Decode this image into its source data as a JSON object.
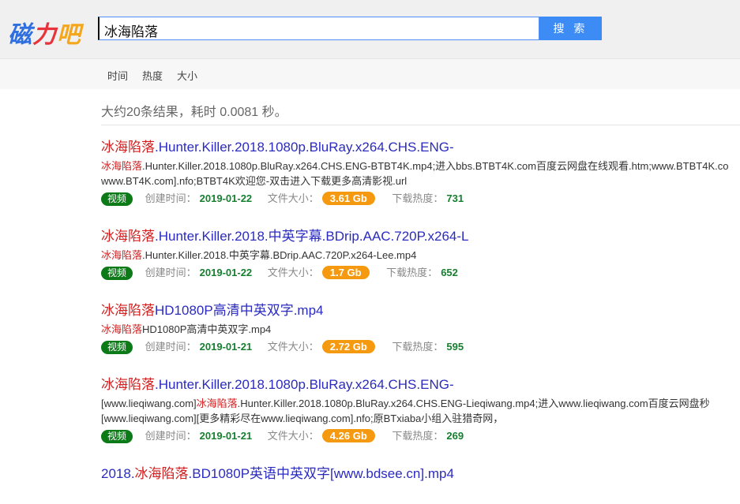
{
  "logo": {
    "part1": "磁",
    "part2": "力",
    "part3": "吧"
  },
  "search": {
    "value": "冰海陷落",
    "button": "搜 索"
  },
  "sort": [
    "时间",
    "热度",
    "大小"
  ],
  "summary": "大约20条结果，耗时 0.0081 秒。",
  "meta_labels": {
    "created": "创建时间：",
    "size": "文件大小：",
    "heat": "下载热度："
  },
  "results": [
    {
      "title": {
        "pre": "",
        "hl": "冰海陷落",
        "post": ".Hunter.Killer.2018.1080p.BluRay.x264.CHS.ENG-"
      },
      "desc": {
        "pre": "",
        "hl": "冰海陷落",
        "post": ".Hunter.Killer.2018.1080p.BluRay.x264.CHS.ENG-BTBT4K.mp4;进入bbs.BTBT4K.com百度云网盘在线观看.htm;www.BTBT4K.co",
        "line2": "www.BT4K.com].nfo;BTBT4K欢迎您-双击进入下载更多高清影视.url"
      },
      "tag": "视频",
      "created": "2019-01-22",
      "size": "3.61 Gb",
      "heat": "731"
    },
    {
      "title": {
        "pre": "",
        "hl": "冰海陷落",
        "post": ".Hunter.Killer.2018.中英字幕.BDrip.AAC.720P.x264-L"
      },
      "desc": {
        "pre": "",
        "hl": "冰海陷落",
        "post": ".Hunter.Killer.2018.中英字幕.BDrip.AAC.720P.x264-Lee.mp4",
        "line2": ""
      },
      "tag": "视频",
      "created": "2019-01-22",
      "size": "1.7 Gb",
      "heat": "652"
    },
    {
      "title": {
        "pre": "",
        "hl": "冰海陷落",
        "post": "HD1080P高清中英双字.mp4"
      },
      "desc": {
        "pre": "",
        "hl": "冰海陷落",
        "post": "HD1080P高清中英双字.mp4",
        "line2": ""
      },
      "tag": "视频",
      "created": "2019-01-21",
      "size": "2.72 Gb",
      "heat": "595"
    },
    {
      "title": {
        "pre": "",
        "hl": "冰海陷落",
        "post": ".Hunter.Killer.2018.1080p.BluRay.x264.CHS.ENG-"
      },
      "desc": {
        "pre": "[www.lieqiwang.com]",
        "hl": "冰海陷落",
        "post": ".Hunter.Killer.2018.1080p.BluRay.x264.CHS.ENG-Lieqiwang.mp4;进入www.lieqiwang.com百度云网盘秒",
        "line2": "[www.lieqiwang.com][更多精彩尽在www.lieqiwang.com].nfo;原BTxiaba小组入驻猎奇网，"
      },
      "tag": "视频",
      "created": "2019-01-21",
      "size": "4.26 Gb",
      "heat": "269"
    },
    {
      "title": {
        "pre": "2018.",
        "hl": "冰海陷落",
        "post": ".BD1080P英语中英双字[www.bdsee.cn].mp4"
      }
    }
  ]
}
